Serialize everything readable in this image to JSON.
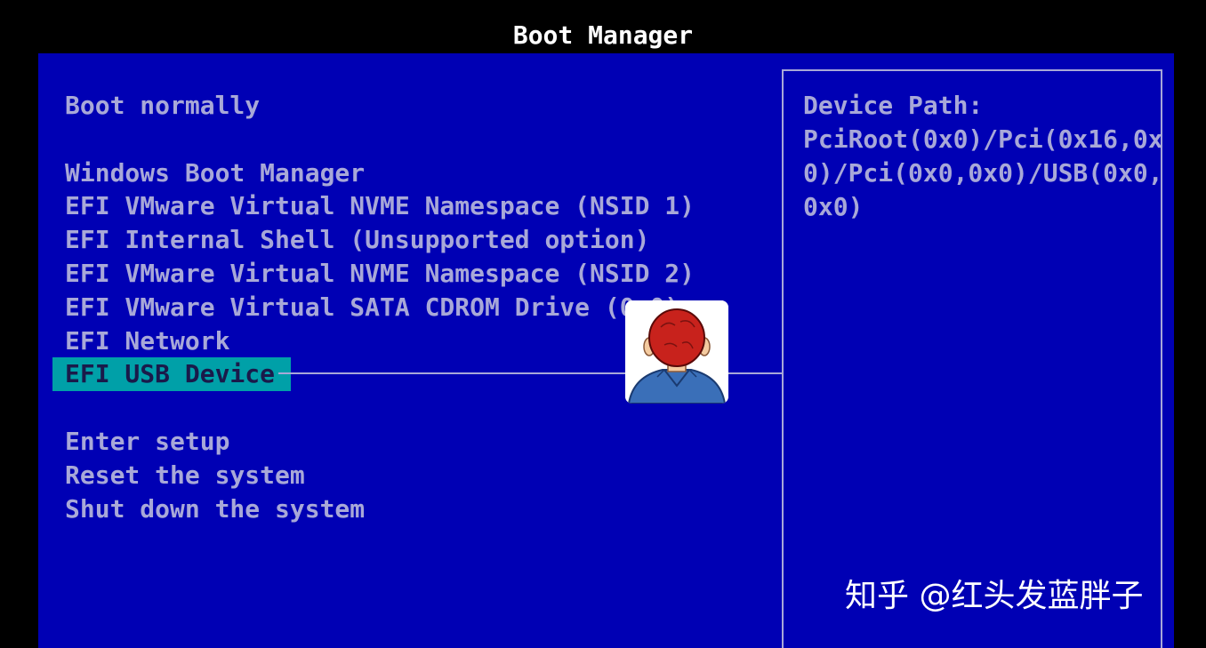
{
  "header": {
    "title": "Boot Manager"
  },
  "menu": {
    "boot_normally": "Boot normally",
    "devices": [
      "Windows Boot Manager",
      "EFI VMware Virtual NVME Namespace (NSID 1)",
      "EFI Internal Shell (Unsupported option)",
      "EFI VMware Virtual NVME Namespace (NSID 2)",
      "EFI VMware Virtual SATA CDROM Drive (0.0)",
      "EFI Network",
      "EFI USB Device"
    ],
    "selected": "EFI USB Device",
    "actions": [
      "Enter setup",
      "Reset the system",
      "Shut down the system"
    ]
  },
  "info": {
    "heading": "Device Path:",
    "lines": [
      "PciRoot(0x0)/Pci(0x16,0x",
      "0)/Pci(0x0,0x0)/USB(0x0,",
      "0x0)"
    ]
  },
  "watermark": {
    "text": "知乎 @红头发蓝胖子"
  },
  "colors": {
    "background": "#0000b4",
    "text": "#a8a8d8",
    "highlight": "#00a0a8",
    "title": "#ffffff"
  }
}
